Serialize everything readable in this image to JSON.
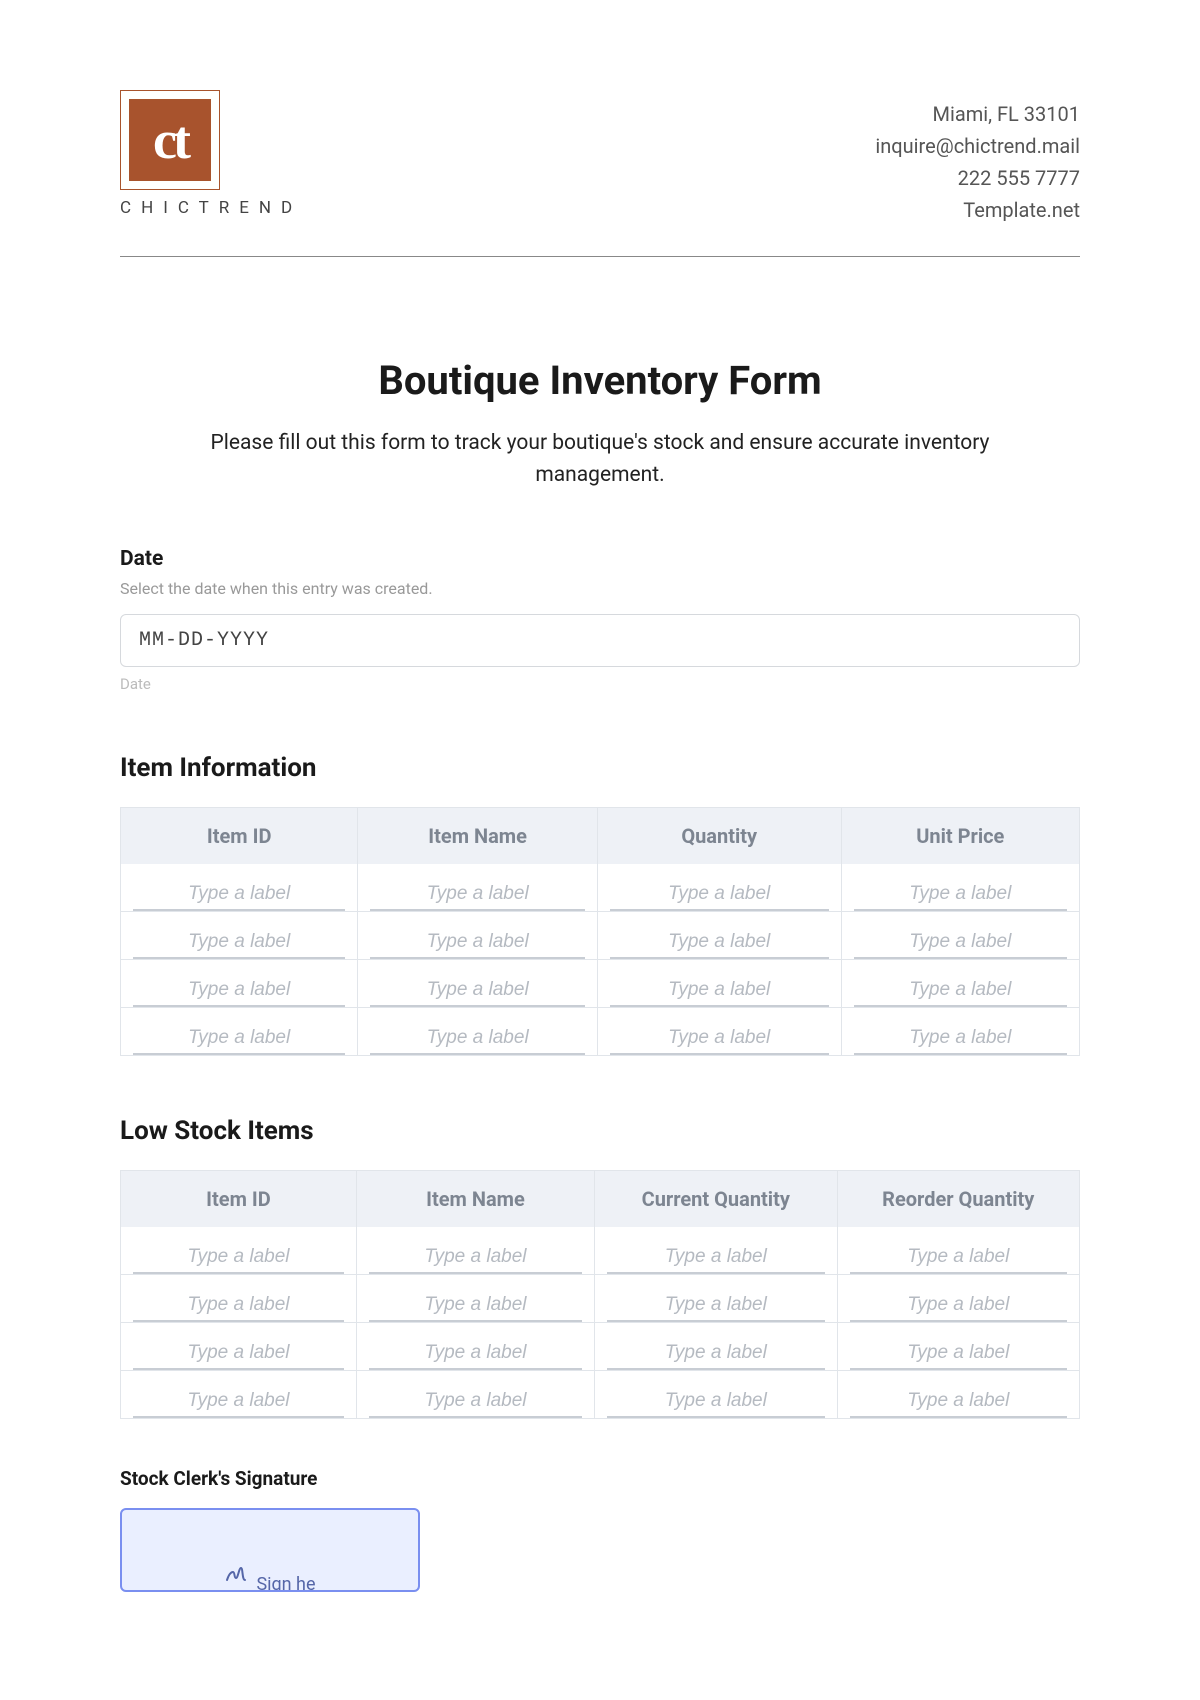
{
  "header": {
    "brand_name": "CHICTREND",
    "logo_glyph": "ct",
    "contact": {
      "address": "Miami, FL 33101",
      "email": "inquire@chictrend.mail",
      "phone": "222 555 7777",
      "site": "Template.net"
    }
  },
  "title": "Boutique Inventory Form",
  "description": "Please fill out this form to track your boutique's stock and ensure accurate inventory management.",
  "date_field": {
    "label": "Date",
    "help": "Select the date when this entry was created.",
    "placeholder": "MM-DD-YYYY",
    "caption": "Date",
    "value": ""
  },
  "item_info": {
    "heading": "Item Information",
    "columns": [
      "Item ID",
      "Item Name",
      "Quantity",
      "Unit Price"
    ],
    "cell_placeholder": "Type a label",
    "rows": 4
  },
  "low_stock": {
    "heading": "Low Stock Items",
    "columns": [
      "Item ID",
      "Item Name",
      "Current Quantity",
      "Reorder Quantity"
    ],
    "cell_placeholder": "Type a label",
    "rows": 4
  },
  "signature": {
    "label": "Stock Clerk's Signature",
    "button_text": "Sign he"
  }
}
